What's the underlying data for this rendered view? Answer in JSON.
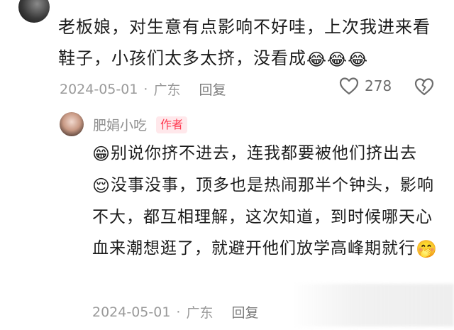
{
  "comment": {
    "text": "老板娘，对生意有点影响不好哇，上次我进来看鞋子，小孩们太多太挤，没看成",
    "emoji_trail": "😂😂😂",
    "date": "2024-05-01",
    "location": "广东",
    "reply_label": "回复",
    "like_count": "278"
  },
  "reply": {
    "author": "肥娟小吃",
    "badge": "作者",
    "line1": "别说你挤不进去，连我都要被他们挤出去",
    "line2": "没事没事，顶多也是热闹那半个钟头，影响不大，都互相理解，这次知道，到时候哪天心血来潮想逛了，就避开他们放学高峰期就行",
    "emoji_1": "😁",
    "emoji_2": "😌",
    "emoji_3": "🤭",
    "date": "2024-05-01",
    "location": "广东",
    "reply_label": "回复"
  },
  "icons": {
    "like": "heart-icon",
    "dislike": "broken-heart-icon"
  },
  "colors": {
    "badge_text": "#ff3b52",
    "badge_bg": "#ffe8eb",
    "meta_gray": "#9a9a9a"
  }
}
